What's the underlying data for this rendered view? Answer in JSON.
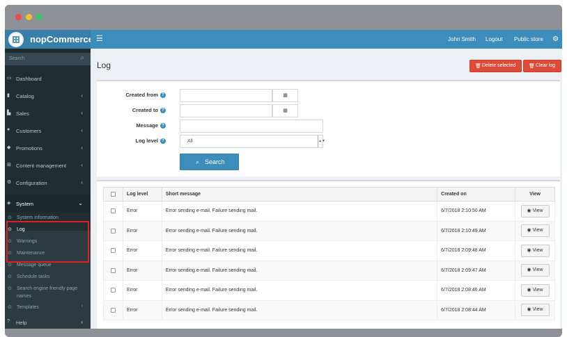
{
  "app": {
    "logo_text": "nopCommerce"
  },
  "topnav": {
    "user": "John Smith",
    "logout": "Logout",
    "public_store": "Public store"
  },
  "sidebar": {
    "search_placeholder": "Search",
    "items": [
      {
        "label": "Dashboard",
        "icon": "desktop-icon",
        "chevron": false
      },
      {
        "label": "Catalog",
        "icon": "book-icon",
        "chevron": true
      },
      {
        "label": "Sales",
        "icon": "cart-icon",
        "chevron": true
      },
      {
        "label": "Customers",
        "icon": "user-icon",
        "chevron": true
      },
      {
        "label": "Promotions",
        "icon": "tag-icon",
        "chevron": true
      },
      {
        "label": "Content management",
        "icon": "sitemap-icon",
        "chevron": true
      },
      {
        "label": "Configuration",
        "icon": "gears-icon",
        "chevron": true
      },
      {
        "label": "System",
        "icon": "cube-icon",
        "chevron": true
      },
      {
        "label": "Help",
        "icon": "question-icon",
        "chevron": true
      }
    ],
    "system_sub": [
      "System information",
      "Log",
      "Warnings",
      "Maintenance",
      "Message queue",
      "Schedule tasks",
      "Search engine friendly page names",
      "Templates"
    ]
  },
  "page": {
    "title": "Log",
    "delete_selected": "Delete selected",
    "clear_log": "Clear log"
  },
  "filters": {
    "created_from": "Created from",
    "created_to": "Created to",
    "message": "Message",
    "log_level": "Log level",
    "log_level_value": "All",
    "search_button": "Search"
  },
  "grid": {
    "headers": [
      "Log level",
      "Short message",
      "Created on",
      "View"
    ],
    "view_label": "View",
    "rows": [
      {
        "level": "Error",
        "message": "Error sending e-mail. Failure sending mail.",
        "created": "6/7/2018 2:10:50 AM"
      },
      {
        "level": "Error",
        "message": "Error sending e-mail. Failure sending mail.",
        "created": "6/7/2018 2:10:49 AM"
      },
      {
        "level": "Error",
        "message": "Error sending e-mail. Failure sending mail.",
        "created": "6/7/2018 2:09:48 AM"
      },
      {
        "level": "Error",
        "message": "Error sending e-mail. Failure sending mail.",
        "created": "6/7/2018 2:09:47 AM"
      },
      {
        "level": "Error",
        "message": "Error sending e-mail. Failure sending mail.",
        "created": "6/7/2018 2:08:46 AM"
      },
      {
        "level": "Error",
        "message": "Error sending e-mail. Failure sending mail.",
        "created": "6/7/2018 2:08:44 AM"
      }
    ]
  },
  "colors": {
    "topnav": "#3c8dbc",
    "sidebar": "#222d32",
    "danger": "#dd4b39",
    "highlight": "#e02020"
  }
}
